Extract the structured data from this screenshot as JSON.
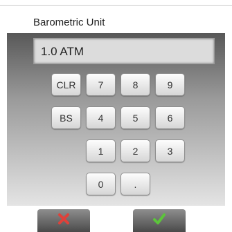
{
  "dialog": {
    "title": "Barometric Unit"
  },
  "display": {
    "value": "1.0 ATM"
  },
  "keypad": {
    "clr": "CLR",
    "bs": "BS",
    "k7": "7",
    "k8": "8",
    "k9": "9",
    "k4": "4",
    "k5": "5",
    "k6": "6",
    "k1": "1",
    "k2": "2",
    "k3": "3",
    "k0": "0",
    "dot": "."
  },
  "actions": {
    "cancel_icon": "cancel-x-icon",
    "confirm_icon": "check-icon"
  },
  "colors": {
    "cancel": "#e0413a",
    "confirm": "#5cc43b"
  }
}
